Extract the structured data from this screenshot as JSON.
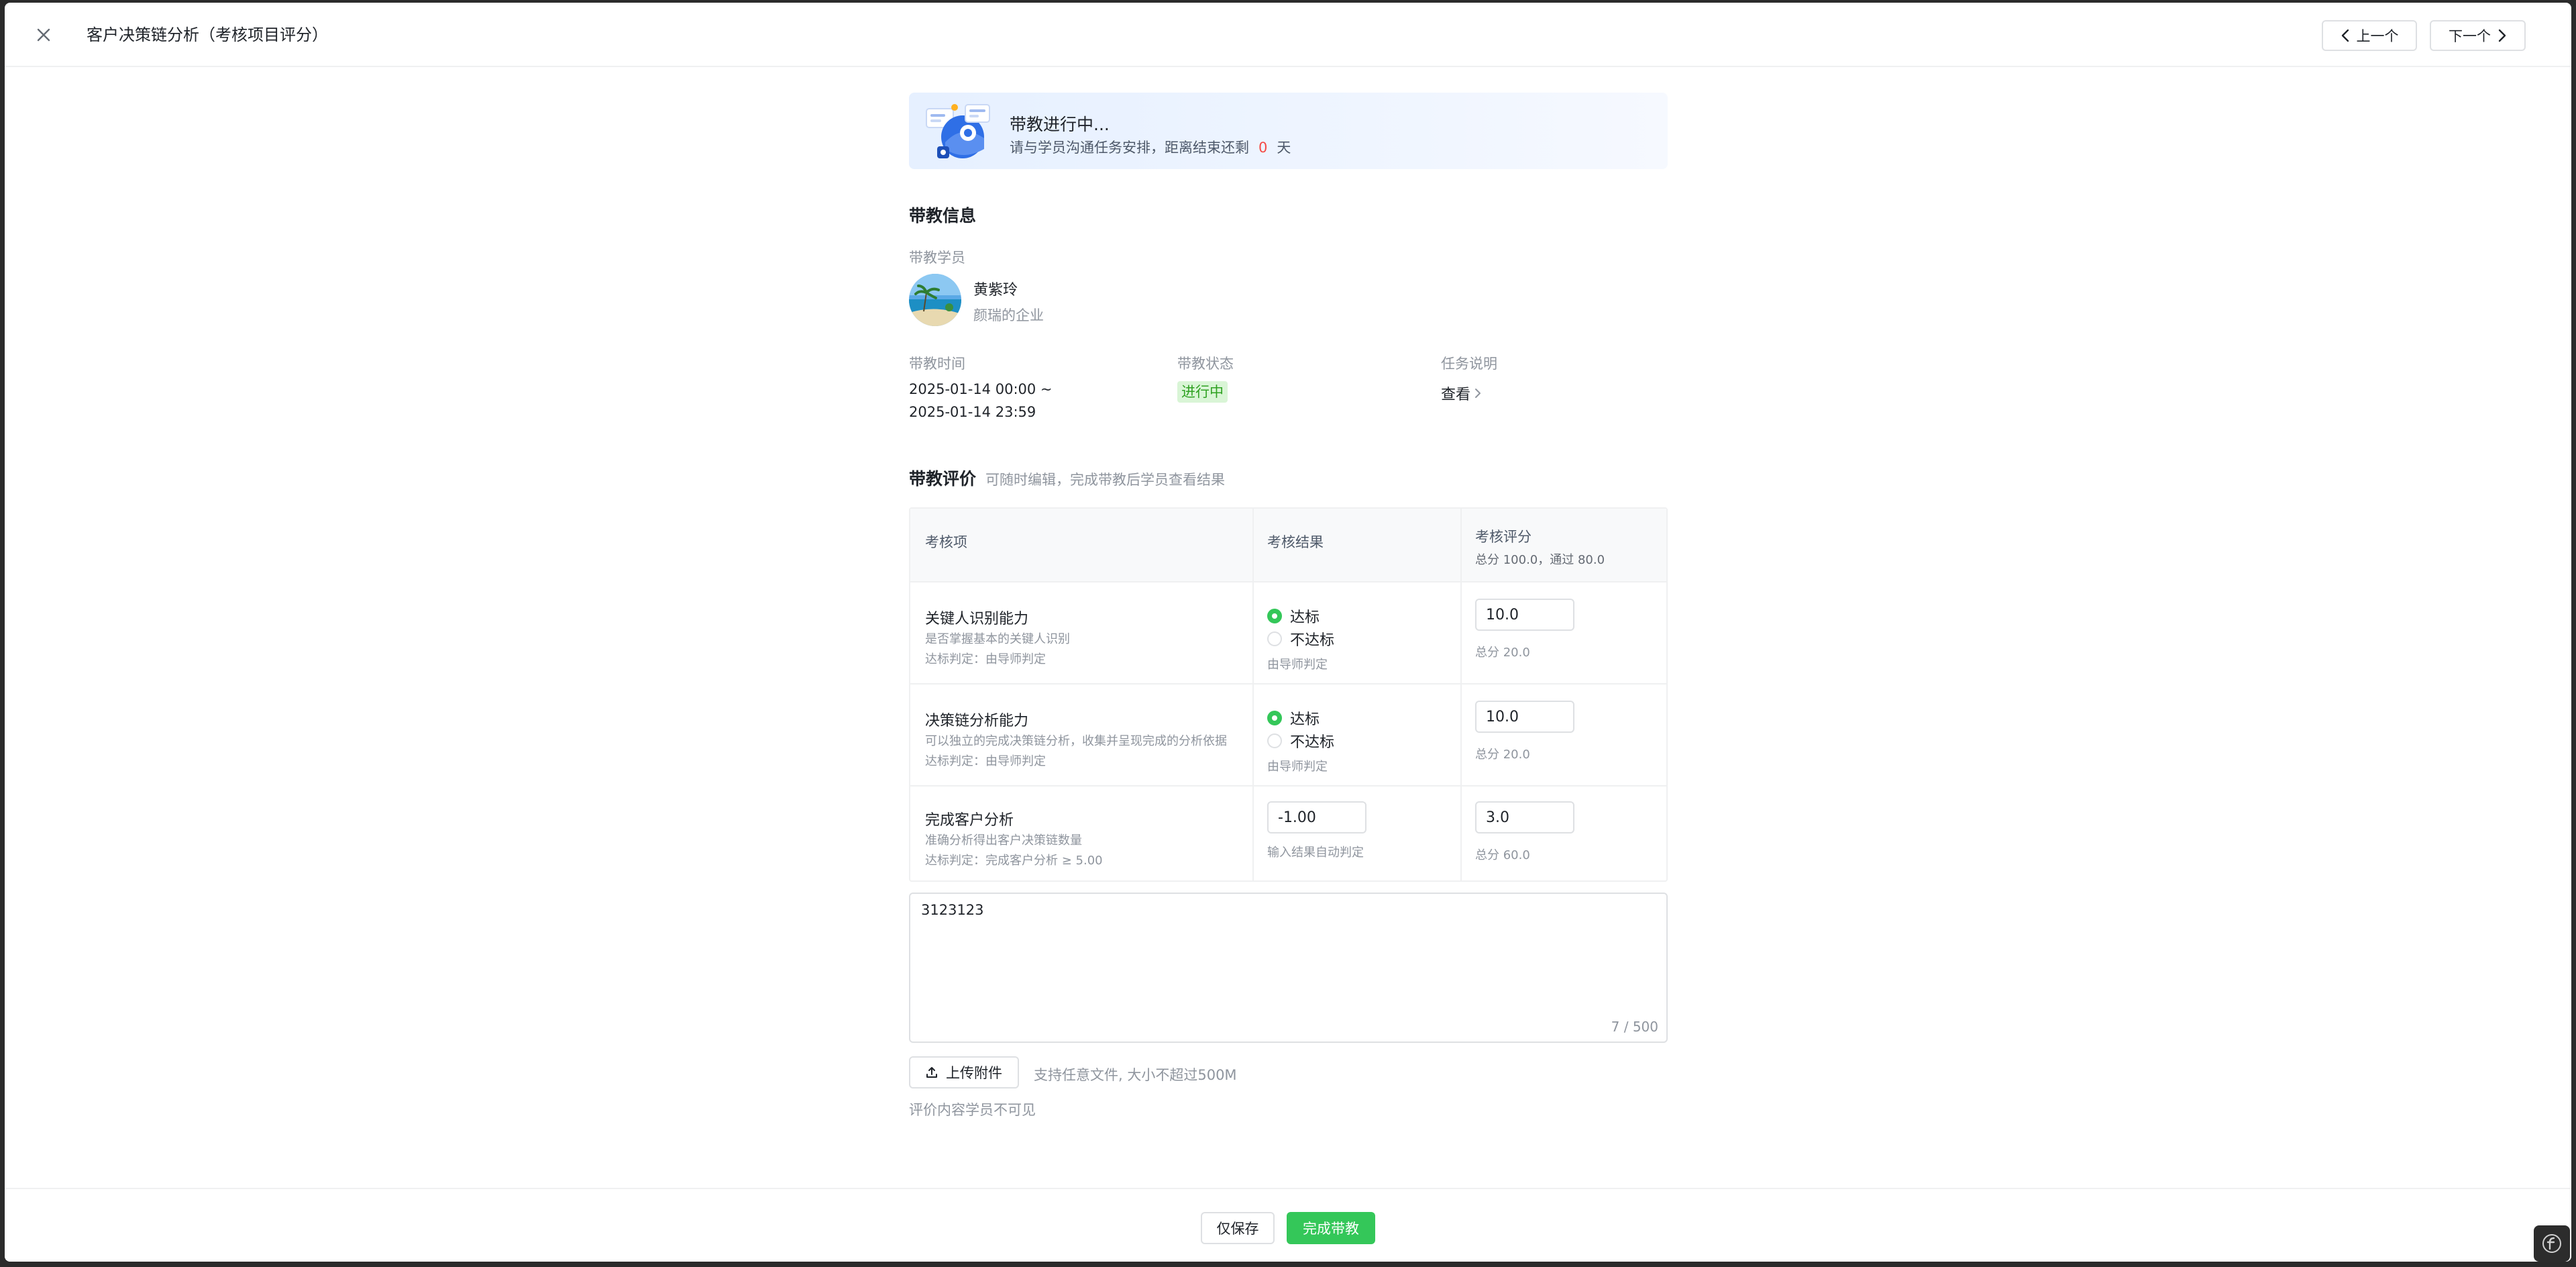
{
  "header": {
    "title": "客户决策链分析（考核项目评分）",
    "prev_label": "上一个",
    "next_label": "下一个"
  },
  "banner": {
    "title": "带教进行中...",
    "subtitle_prefix": "请与学员沟通任务安排，距离结束还剩",
    "days": "0",
    "days_unit": "天"
  },
  "info": {
    "section_title": "带教信息",
    "student_label": "带教学员",
    "student_name": "黄紫玲",
    "student_company": "颜瑞的企业",
    "time_label": "带教时间",
    "time_start": "2025-01-14 00:00 ~",
    "time_end": "2025-01-14 23:59",
    "status_label": "带教状态",
    "status_value": "进行中",
    "task_label": "任务说明",
    "task_link": "查看"
  },
  "evaluation": {
    "title": "带教评价",
    "hint": "可随时编辑，完成带教后学员查看结果",
    "columns": {
      "item": "考核项",
      "result": "考核结果",
      "score": "考核评分",
      "score_sub": "总分 100.0，通过 80.0"
    },
    "rows": [
      {
        "name": "关键人识别能力",
        "desc": "是否掌握基本的关键人识别",
        "rule": "达标判定：由导师判定",
        "option_pass": "达标",
        "option_fail": "不达标",
        "selected": "pass",
        "result_note": "由导师判定",
        "score": "10.0",
        "score_total": "总分 20.0"
      },
      {
        "name": "决策链分析能力",
        "desc": "可以独立的完成决策链分析，收集并呈现完成的分析依据",
        "rule": "达标判定：由导师判定",
        "option_pass": "达标",
        "option_fail": "不达标",
        "selected": "pass",
        "result_note": "由导师判定",
        "score": "10.0",
        "score_total": "总分 20.0"
      },
      {
        "name": "完成客户分析",
        "desc": "准确分析得出客户决策链数量",
        "rule": "达标判定：完成客户分析 ≥ 5.00",
        "result_value": "-1.00",
        "result_note": "输入结果自动判定",
        "score": "3.0",
        "score_total": "总分 60.0"
      }
    ],
    "comment": "3123123",
    "char_count": "7 / 500",
    "upload_label": "上传附件",
    "upload_hint": "支持任意文件, 大小不超过500M",
    "visibility_note": "评价内容学员不可见"
  },
  "footer": {
    "save_label": "仅保存",
    "finish_label": "完成带教"
  },
  "colors": {
    "accent_green": "#34c759",
    "status_green": "#2ea121",
    "days_red": "#f54a45"
  }
}
